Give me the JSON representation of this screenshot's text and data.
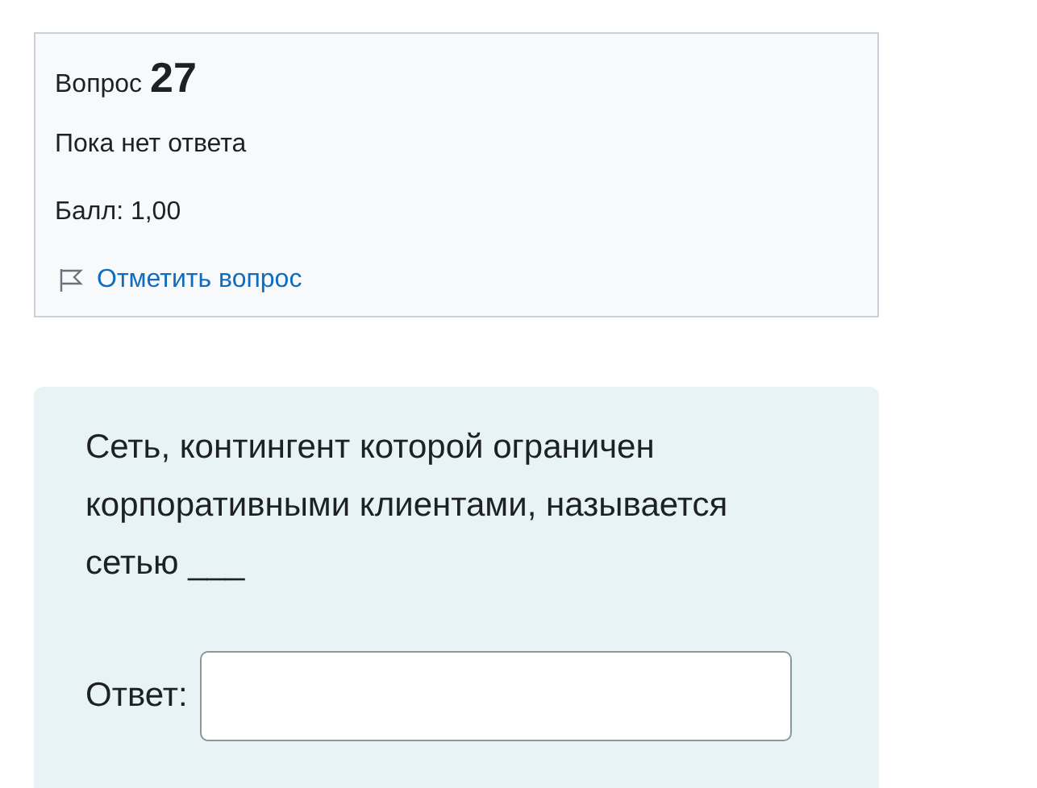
{
  "info": {
    "label": "Вопрос",
    "number": "27",
    "status": "Пока нет ответа",
    "grade": "Балл: 1,00",
    "flag_link": "Отметить вопрос"
  },
  "question": {
    "text": "Сеть, контингент которой ограничен корпоративными клиентами, называется сетью ___",
    "answer_label": "Ответ:"
  }
}
